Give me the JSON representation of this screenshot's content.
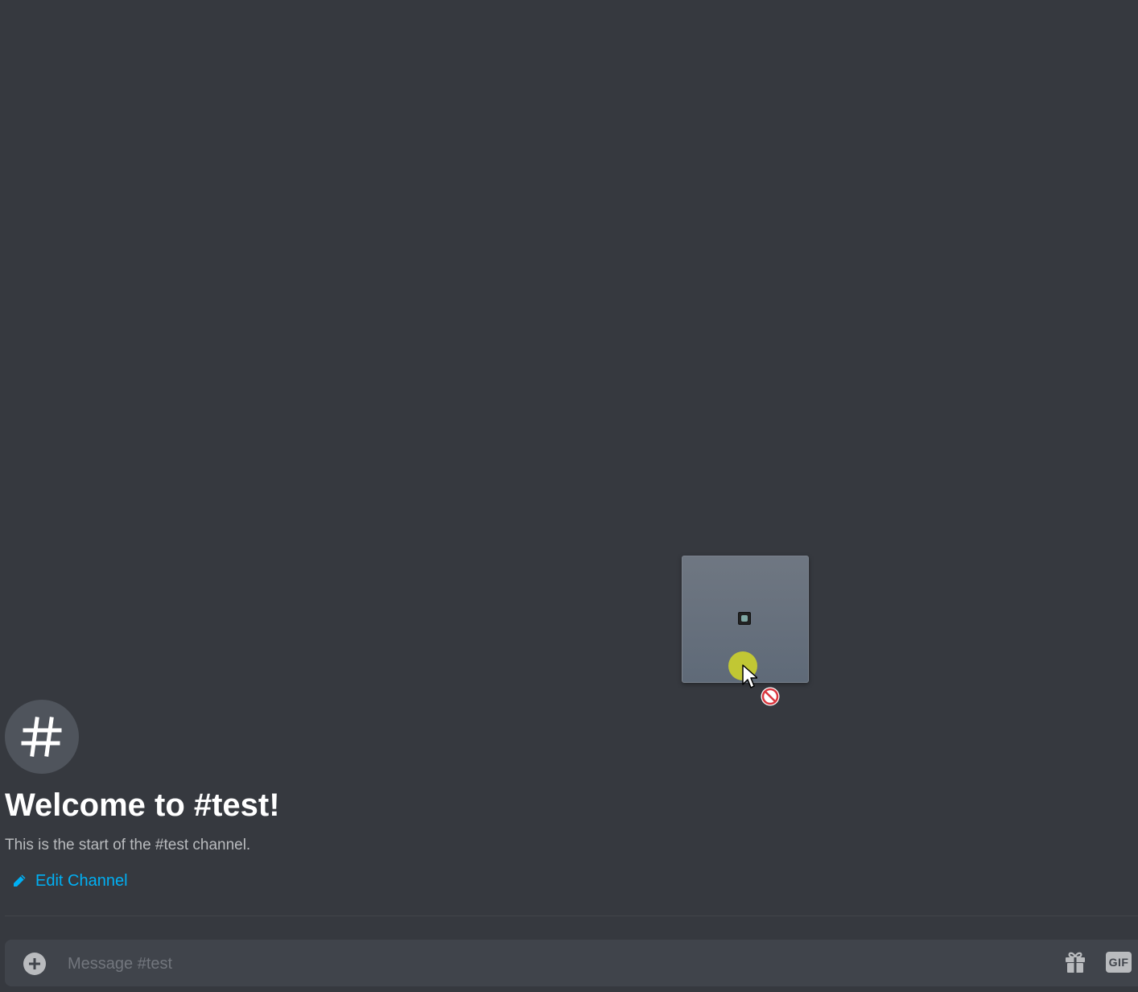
{
  "channel": {
    "avatar_glyph": "#",
    "welcome_title": "Welcome to #test!",
    "welcome_subtitle": "This is the start of the #test channel.",
    "edit_label": "Edit Channel"
  },
  "composer": {
    "placeholder": "Message #test",
    "gif_label": "GIF"
  },
  "drag_preview": {
    "cursor_state": "no-drop"
  },
  "colors": {
    "background": "#36393f",
    "composer": "#40444b",
    "link": "#00b0f4",
    "title": "#ffffff",
    "subtitle": "#b9bbbe"
  },
  "icons": [
    "hash-icon",
    "pencil-icon",
    "plus-circle-icon",
    "gift-icon",
    "gif-icon",
    "cursor-arrow-icon",
    "no-drop-icon"
  ]
}
